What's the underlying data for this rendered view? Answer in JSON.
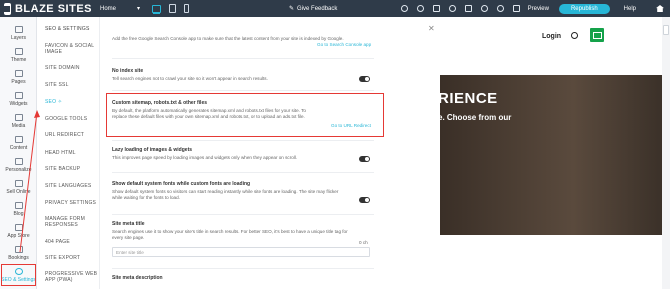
{
  "topbar": {
    "logo": "BLAZE SITES",
    "page_select": "Home",
    "feedback": "Give Feedback",
    "preview": "Preview",
    "republish": "Republish",
    "help": "Help"
  },
  "iconbar": {
    "items": [
      {
        "label": "Layers",
        "icon": "layers-icon"
      },
      {
        "label": "Theme",
        "icon": "theme-icon"
      },
      {
        "label": "Pages",
        "icon": "pages-icon"
      },
      {
        "label": "Widgets",
        "icon": "widgets-icon"
      },
      {
        "label": "Media",
        "icon": "media-icon"
      },
      {
        "label": "Content",
        "icon": "content-icon"
      },
      {
        "label": "Personalize",
        "icon": "personalize-icon"
      },
      {
        "label": "Sell Online",
        "icon": "sell-online-icon"
      },
      {
        "label": "Blog",
        "icon": "blog-icon"
      },
      {
        "label": "App Store",
        "icon": "app-store-icon"
      },
      {
        "label": "Bookings",
        "icon": "bookings-icon"
      },
      {
        "label": "SEO & Settings",
        "icon": "seo-settings-icon"
      }
    ]
  },
  "settings_nav": {
    "title": "SEO & SETTINGS",
    "items": [
      "FAVICON & SOCIAL IMAGE",
      "SITE DOMAIN",
      "SITE SSL",
      "SEO",
      "GOOGLE TOOLS",
      "URL REDIRECT",
      "HEAD HTML",
      "SITE BACKUP",
      "SITE LANGUAGES",
      "PRIVACY SETTINGS",
      "MANAGE FORM RESPONSES",
      "404 PAGE",
      "SITE EXPORT",
      "PROGRESSIVE WEB APP (PWA)"
    ]
  },
  "content": {
    "top_desc": "Add the free Google Search Console app to make sure that the latest content from your site is indexed by Google.",
    "top_link": "Go to Search Console app",
    "noindex": {
      "title": "No index site",
      "desc": "Tell search engines not to crawl your site so it won't appear in search results."
    },
    "custom": {
      "title": "Custom sitemap, robots.txt & other files",
      "desc": "By default, the platform automatically generates sitemap.xml and robots.txt files for your site. To replace these default files with your own sitemap.xml and robots.txt, or to upload an ads.txt file.",
      "link": "Go to URL Redirect"
    },
    "lazy": {
      "title": "Lazy loading of images & widgets",
      "desc": "This improves page speed by loading images and widgets only when they appear on scroll."
    },
    "fonts": {
      "title": "Show default system fonts while custom fonts are loading",
      "desc": "Show default system fonts so visitors can start reading instantly while site fonts are loading. The site may flicker while waiting for the fonts to load."
    },
    "meta_title": {
      "title": "Site meta title",
      "desc": "Search engines use it to show your site's title in search results. For better SEO, it's best to have a unique title tag for every site page.",
      "counter": "0 ch",
      "placeholder": "Enter site title"
    },
    "meta_desc": {
      "title": "Site meta description"
    }
  },
  "site_preview": {
    "login": "Login",
    "hero_heading": "RIENCE",
    "hero_text": "e. Choose from our"
  }
}
